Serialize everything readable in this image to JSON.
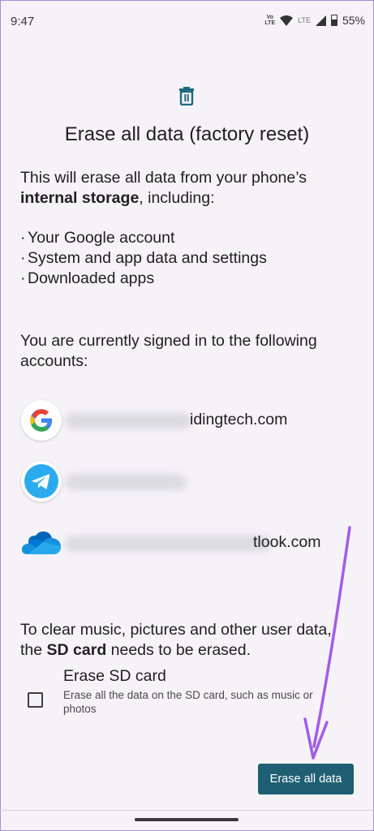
{
  "status_bar": {
    "time": "9:47",
    "volte_top": "Vo",
    "volte_bottom": "LTE",
    "lte": "LTE",
    "battery": "55%"
  },
  "dialog": {
    "icon": "trash-icon",
    "title": "Erase all data (factory reset)",
    "description_start": "This will erase all data from your phone’s ",
    "description_bold": "internal storage",
    "description_end": ", including:",
    "bullets": [
      "Your Google account",
      "System and app data and settings",
      "Downloaded apps"
    ],
    "signed_in_text": "You are currently signed in to the following accounts:",
    "accounts": [
      {
        "icon": "google-icon",
        "visible_text": "idingtech.com"
      },
      {
        "icon": "telegram-icon",
        "visible_text": ""
      },
      {
        "icon": "onedrive-icon",
        "visible_text": "tlook.com"
      }
    ],
    "sd_text_start": "To clear music, pictures and other user data, the ",
    "sd_text_bold": "SD card",
    "sd_text_end": " needs to be erased.",
    "sd_option": {
      "title": "Erase SD card",
      "subtitle": "Erase all the data on the SD card, such as music or photos",
      "checked": false
    },
    "erase_button": "Erase all data"
  },
  "colors": {
    "background": "#f5f3f8",
    "button": "#1f5f73",
    "trash_icon": "#1f6b7e",
    "annotation_arrow": "#a35ce8"
  }
}
